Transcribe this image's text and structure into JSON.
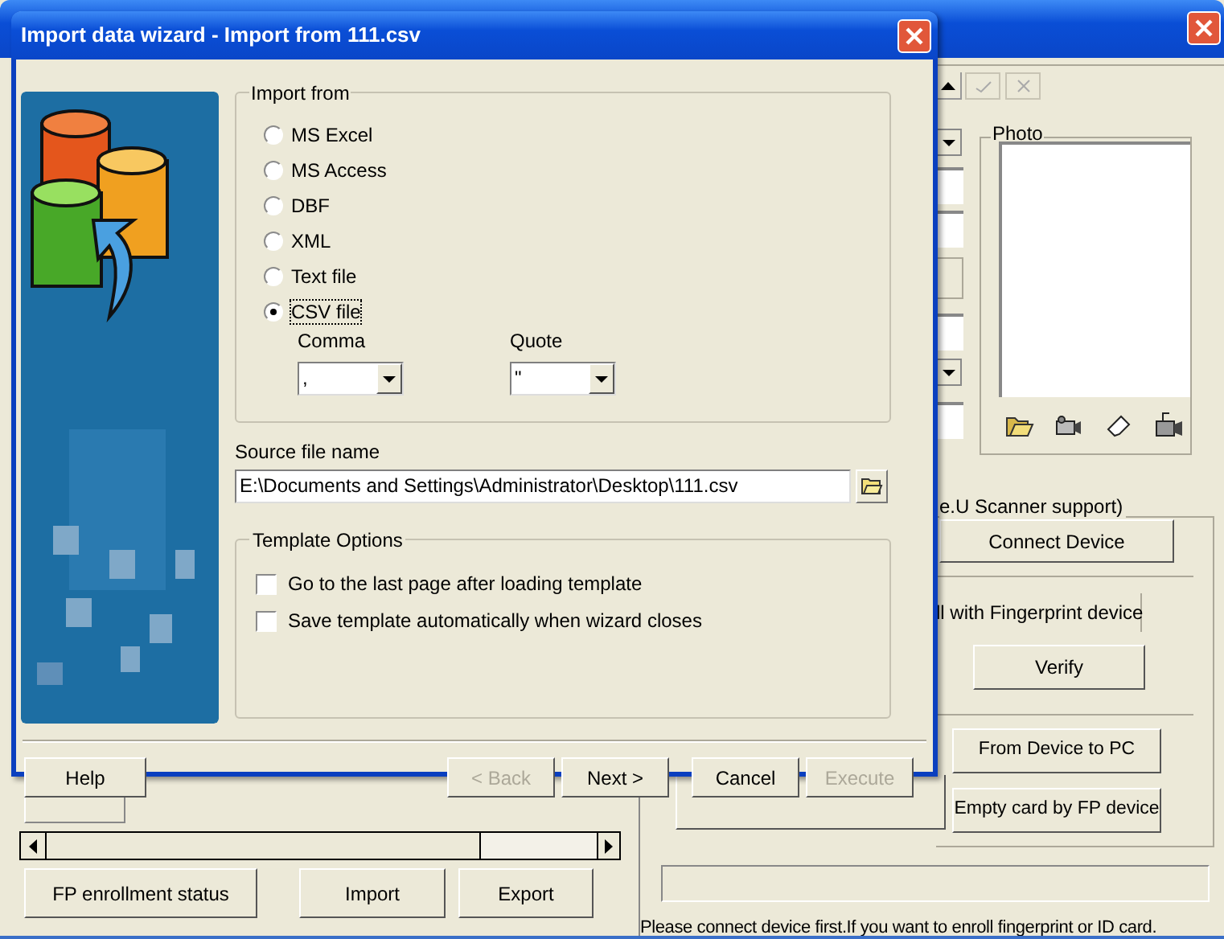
{
  "background_window": {
    "photo": {
      "label": "Photo"
    },
    "device_group": {
      "label": "e.U Scanner support)"
    },
    "connect_button": "Connect Device",
    "enroll_tab": "ll with Fingerprint device",
    "verify_button": "Verify",
    "transfer_buttons": [
      "From Device to PC",
      "Empty card by FP device"
    ],
    "bottom_buttons": [
      "FP enrollment status",
      "Import",
      "Export"
    ],
    "progress": {
      "level": 0
    },
    "status_text": "Please connect device first.If you want to enroll fingerprint or ID card."
  },
  "wizard": {
    "title": "Import data wizard - Import from 111.csv",
    "import_from": {
      "label": "Import from",
      "options": [
        {
          "label": "MS Excel",
          "selected": false
        },
        {
          "label": "MS Access",
          "selected": false
        },
        {
          "label": "DBF",
          "selected": false
        },
        {
          "label": "XML",
          "selected": false
        },
        {
          "label": "Text file",
          "selected": false
        },
        {
          "label": "CSV file",
          "selected": true
        }
      ]
    },
    "comma": {
      "label": "Comma",
      "value": ","
    },
    "quote": {
      "label": "Quote",
      "value": "\""
    },
    "source_file": {
      "label": "Source file name",
      "value": "E:\\Documents and Settings\\Administrator\\Desktop\\111.csv"
    },
    "template_options": {
      "label": "Template Options",
      "options": [
        {
          "label": "Go to the last page after loading template",
          "checked": false
        },
        {
          "label": "Save template automatically when wizard closes",
          "checked": false
        }
      ]
    },
    "buttons": [
      {
        "kind": "help",
        "label": "Help",
        "disabled": false
      },
      {
        "kind": "nav",
        "label": "< Back",
        "disabled": true
      },
      {
        "kind": "nav",
        "label": "Next >",
        "disabled": false
      },
      {
        "kind": "gap",
        "label": "Cancel",
        "disabled": false
      },
      {
        "kind": "nav",
        "label": "Execute",
        "disabled": true
      }
    ]
  }
}
